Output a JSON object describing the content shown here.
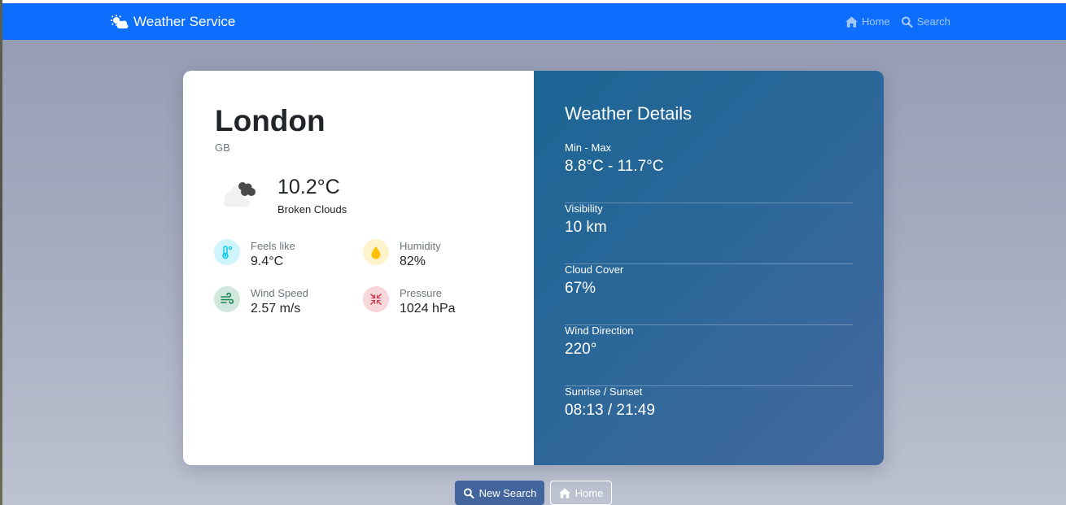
{
  "navbar": {
    "brand": "Weather Service",
    "links": [
      {
        "label": "Home",
        "icon": "home-icon"
      },
      {
        "label": "Search",
        "icon": "search-icon"
      }
    ]
  },
  "current": {
    "city": "London",
    "country": "GB",
    "icon": "broken-clouds-icon",
    "temperature": "10.2°C",
    "description": "Broken Clouds",
    "stats": [
      {
        "label": "Feels like",
        "value": "9.4°C",
        "icon": "thermometer-icon",
        "color": "#0dcaf0"
      },
      {
        "label": "Humidity",
        "value": "82%",
        "icon": "droplet-icon",
        "color": "#ffc107"
      },
      {
        "label": "Wind Speed",
        "value": "2.57 m/s",
        "icon": "wind-icon",
        "color": "#198754"
      },
      {
        "label": "Pressure",
        "value": "1024 hPa",
        "icon": "compress-icon",
        "color": "#dc3545"
      }
    ]
  },
  "details": {
    "title": "Weather Details",
    "items": [
      {
        "label": "Min - Max",
        "value": "8.8°C - 11.7°C"
      },
      {
        "label": "Visibility",
        "value": "10 km"
      },
      {
        "label": "Cloud Cover",
        "value": "67%"
      },
      {
        "label": "Wind Direction",
        "value": "220°"
      },
      {
        "label": "Sunrise / Sunset",
        "value": "08:13 / 21:49"
      }
    ]
  },
  "actions": {
    "new_search": "New Search",
    "home": "Home"
  }
}
